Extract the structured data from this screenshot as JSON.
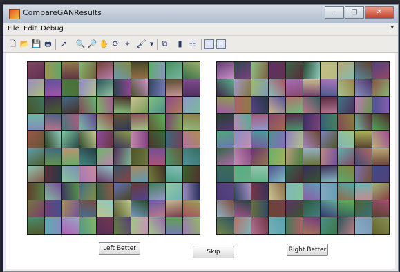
{
  "window": {
    "title": "CompareGANResults",
    "controls": [
      "–",
      "□",
      "✕"
    ]
  },
  "menu": {
    "items": [
      "File",
      "Edit",
      "Debug"
    ],
    "overflow": "▾"
  },
  "toolbar": {
    "tools": [
      {
        "name": "new-figure-icon",
        "glyph": "🗋"
      },
      {
        "name": "open-file-icon",
        "glyph": "📂"
      },
      {
        "name": "save-icon",
        "glyph": "💾"
      },
      {
        "name": "print-icon",
        "glyph": "🖶"
      },
      {
        "name": "edit-arrow-icon",
        "glyph": "➚"
      },
      {
        "name": "zoom-in-icon",
        "glyph": "🔍"
      },
      {
        "name": "zoom-out-icon",
        "glyph": "🔎"
      },
      {
        "name": "pan-hand-icon",
        "glyph": "✋"
      },
      {
        "name": "rotate-3d-icon",
        "glyph": "⟳"
      },
      {
        "name": "data-cursor-icon",
        "glyph": "⌖"
      },
      {
        "name": "brush-icon",
        "glyph": "🖌"
      },
      {
        "name": "brush-dropdown-icon",
        "glyph": "▾"
      },
      {
        "name": "link-plot-icon",
        "glyph": "⧉"
      },
      {
        "name": "colorbar-icon",
        "glyph": "▮"
      },
      {
        "name": "legend-icon",
        "glyph": "☷"
      },
      {
        "name": "hide-plot-tools-icon",
        "glyph": ""
      },
      {
        "name": "show-plot-tools-icon",
        "glyph": ""
      }
    ]
  },
  "left_grid": {
    "rows": 10,
    "cols": 10
  },
  "right_grid": {
    "rows": 10,
    "cols": 10
  },
  "buttons": {
    "left": "Left Better",
    "skip": "Skip",
    "right": "Right Better"
  }
}
